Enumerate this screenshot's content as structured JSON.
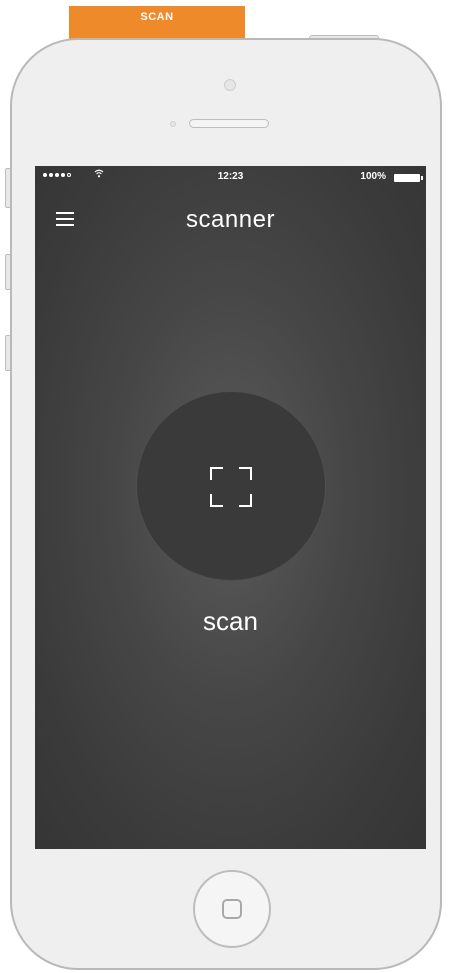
{
  "banner": {
    "label": "SCAN"
  },
  "status_bar": {
    "time": "12:23",
    "battery": "100%",
    "signal_icon": "signal-dots-icon",
    "wifi_icon": "wifi-icon",
    "battery_icon": "battery-icon"
  },
  "header": {
    "title": "scanner",
    "menu_icon": "hamburger-menu-icon"
  },
  "main": {
    "scan_icon": "scan-frame-icon",
    "scan_label": "scan"
  },
  "device": {
    "home_button_icon": "home-square-icon"
  },
  "colors": {
    "accent": "#ee8a2a",
    "screen_bg": "#3b3b3b",
    "phone_body": "#efefef",
    "text": "#ffffff"
  }
}
